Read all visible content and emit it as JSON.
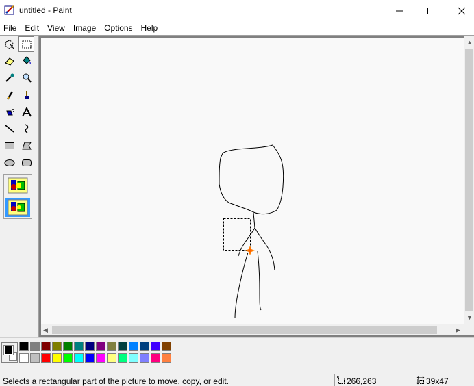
{
  "window": {
    "title": "untitled - Paint",
    "icon": "paint-app-icon",
    "controls": [
      "minimize-icon",
      "maximize-icon",
      "close-icon"
    ]
  },
  "menu": [
    {
      "label": "File"
    },
    {
      "label": "Edit"
    },
    {
      "label": "View"
    },
    {
      "label": "Image"
    },
    {
      "label": "Options"
    },
    {
      "label": "Help"
    }
  ],
  "toolbox": {
    "tools": [
      {
        "name": "free-form-select",
        "icon": "free-select-icon",
        "selected": false
      },
      {
        "name": "select",
        "icon": "rect-select-icon",
        "selected": true
      },
      {
        "name": "eraser",
        "icon": "eraser-icon",
        "selected": false
      },
      {
        "name": "fill-with-color",
        "icon": "fill-bucket-icon",
        "selected": false
      },
      {
        "name": "pick-color",
        "icon": "eyedropper-icon",
        "selected": false
      },
      {
        "name": "magnifier",
        "icon": "magnifier-icon",
        "selected": false
      },
      {
        "name": "pencil",
        "icon": "pencil-icon",
        "selected": false
      },
      {
        "name": "brush",
        "icon": "brush-icon",
        "selected": false
      },
      {
        "name": "airbrush",
        "icon": "airbrush-icon",
        "selected": false
      },
      {
        "name": "text",
        "icon": "text-icon",
        "selected": false
      },
      {
        "name": "line",
        "icon": "line-icon",
        "selected": false
      },
      {
        "name": "curve",
        "icon": "curve-icon",
        "selected": false
      },
      {
        "name": "rectangle",
        "icon": "rectangle-icon",
        "selected": false
      },
      {
        "name": "polygon",
        "icon": "polygon-icon",
        "selected": false
      },
      {
        "name": "ellipse",
        "icon": "ellipse-icon",
        "selected": false
      },
      {
        "name": "rounded-rectangle",
        "icon": "rounded-rect-icon",
        "selected": false
      }
    ],
    "options": [
      {
        "name": "opaque-selection",
        "icon": "opaque-selection-icon",
        "selected": false
      },
      {
        "name": "transparent-selection",
        "icon": "transparent-selection-icon",
        "selected": true
      }
    ]
  },
  "palette": {
    "foreground": "#000000",
    "background": "#ffffff",
    "row1": [
      "#000000",
      "#808080",
      "#800000",
      "#808000",
      "#008000",
      "#008080",
      "#000080",
      "#800080",
      "#808040",
      "#004040",
      "#0080ff",
      "#004080",
      "#4000ff",
      "#804000"
    ],
    "row2": [
      "#ffffff",
      "#c0c0c0",
      "#ff0000",
      "#ffff00",
      "#00ff00",
      "#00ffff",
      "#0000ff",
      "#ff00ff",
      "#ffff80",
      "#00ff80",
      "#80ffff",
      "#8080ff",
      "#ff0080",
      "#ff8040"
    ]
  },
  "status": {
    "help_text": "Selects a rectangular part of the picture to move, copy, or edit.",
    "cursor_position": "266,263",
    "selection_size": "39x47"
  }
}
